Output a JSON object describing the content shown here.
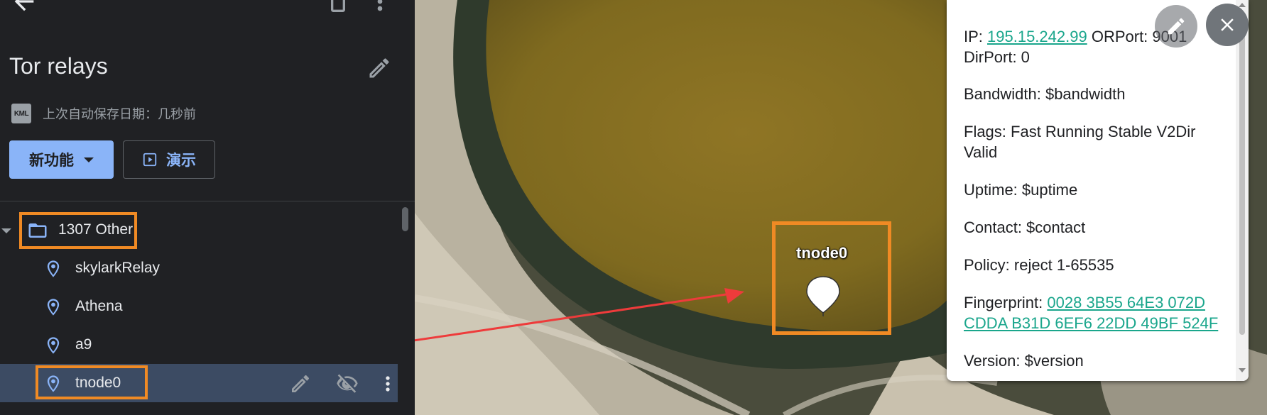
{
  "sidebar": {
    "project_title": "Tor relays",
    "autosave_icon_text": "KML",
    "autosave_text": "上次自动保存日期：几秒前",
    "new_button_label": "新功能",
    "present_button_label": "演示",
    "folder": {
      "label": "1307 Other"
    },
    "items": [
      {
        "label": "skylarkRelay"
      },
      {
        "label": "Athena"
      },
      {
        "label": "a9"
      },
      {
        "label": "tnode0"
      }
    ]
  },
  "map": {
    "marker_label": "tnode0"
  },
  "popup": {
    "ip_label": "IP: ",
    "ip_value": "195.15.242.99",
    "orport": " ORPort: 9001",
    "dirport": "DirPort: 0",
    "bandwidth": "Bandwidth: $bandwidth",
    "flags": "Flags: Fast Running Stable V2Dir Valid",
    "uptime": "Uptime: $uptime",
    "contact": "Contact: $contact",
    "policy": "Policy: reject 1-65535",
    "fingerprint_label": "Fingerprint: ",
    "fingerprint_value": "0028 3B55 64E3 072D CDDA B31D 6EF6 22DD 49BF 524F",
    "version": "Version: $version"
  },
  "colors": {
    "highlight": "#f08a24",
    "accent": "#8ab4f8",
    "link": "#1aa68c",
    "arrow": "#ee3b3b"
  },
  "icons": [
    "back-arrow-icon",
    "trash-icon",
    "more-vert-icon",
    "pencil-icon",
    "kml-file-icon",
    "chevron-down-icon",
    "play-icon",
    "folder-icon",
    "place-pin-icon",
    "visibility-off-icon",
    "close-icon"
  ]
}
